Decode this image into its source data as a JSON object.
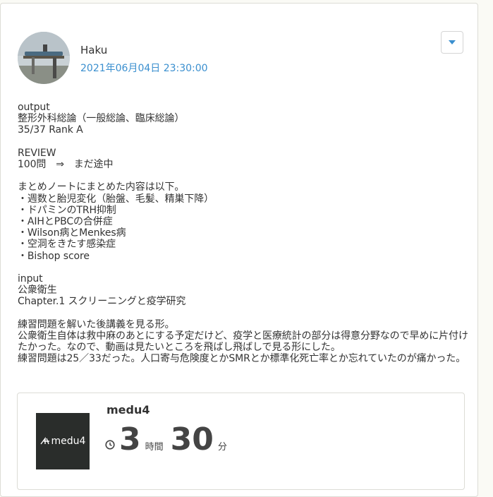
{
  "post": {
    "author": "Haku",
    "timestamp": "2021年06月04日 23:30:00",
    "body": "output\n整形外科総論（一般総論、臨床総論）\n35/37 Rank A\n\nREVIEW\n100問　⇒　まだ途中\n\nまとめノートにまとめた内容は以下。\n・週数と胎児変化（胎盤、毛髪、精巣下降）\n・ドパミンのTRH抑制\n・AIHとPBCの合併症\n・Wilson病とMenkes病\n・空洞をきたす感染症\n・Bishop score\n\ninput\n公衆衛生\nChapter.1 スクリーニングと疫学研究\n\n練習問題を解いた後講義を見る形。\n公衆衛生自体は救中麻のあとにする予定だけど、疫学と医療統計の部分は得意分野なので早めに片付けたかった。なので、動画は見たいところを飛ばし飛ばしで見る形にした。\n練習問題は25／33だった。人口寄与危険度とかSMRとか標準化死亡率とか忘れていたのが痛かった。"
  },
  "study": {
    "title": "medu4",
    "logo_text": "medu4",
    "hours": "3",
    "hours_unit": "時間",
    "minutes": "30",
    "minutes_unit": "分"
  },
  "icons": {
    "dropdown": "chevron-down-icon",
    "clock": "clock-icon"
  },
  "colors": {
    "accent": "#3a8fcf",
    "text": "#333333",
    "logo_bg": "#2a2d2b"
  }
}
